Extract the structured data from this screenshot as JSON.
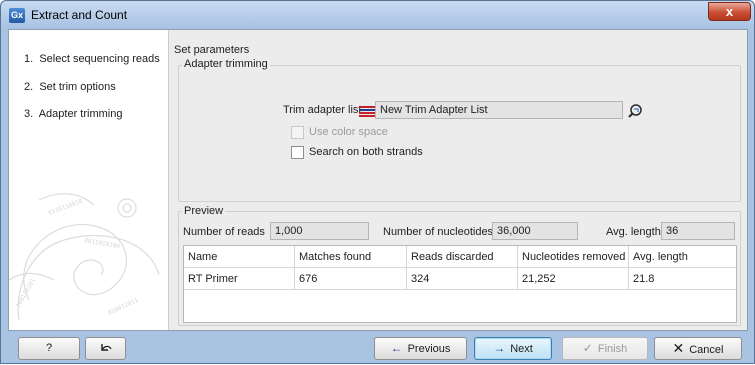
{
  "window": {
    "app_icon": "Gx",
    "title": "Extract and Count",
    "close_glyph": "x"
  },
  "sidebar": {
    "steps": [
      {
        "number": "1.",
        "label": "Select sequencing reads"
      },
      {
        "number": "2.",
        "label": "Set trim options"
      },
      {
        "number": "3.",
        "label": "Adapter trimming"
      }
    ]
  },
  "main": {
    "section_title": "Set parameters",
    "adapter_group": {
      "title": "Adapter trimming",
      "trim_label": "Trim adapter list",
      "trim_value": "New Trim Adapter List",
      "browse_icon": "browse-icon",
      "use_color_space": {
        "label": "Use color space",
        "checked": false,
        "enabled": false
      },
      "search_both": {
        "label": "Search on both strands",
        "checked": false,
        "enabled": true
      }
    },
    "preview": {
      "title": "Preview",
      "reads_label": "Number of reads",
      "reads_value": "1,000",
      "nucleotides_label": "Number of nucleotides",
      "nucleotides_value": "36,000",
      "avg_label": "Avg. length",
      "avg_value": "36",
      "table": {
        "columns": [
          "Name",
          "Matches found",
          "Reads discarded",
          "Nucleotides removed",
          "Avg. length"
        ],
        "rows": [
          [
            "RT Primer",
            "676",
            "324",
            "21,252",
            "21.8"
          ]
        ]
      }
    }
  },
  "footer": {
    "help": "?",
    "reset_icon": "reset-icon",
    "previous": "Previous",
    "next": "Next",
    "finish": "Finish",
    "cancel": "Cancel"
  },
  "colors": {
    "titlebar": "#a9c4e2",
    "content_bg": "#ececec",
    "flag_red": "#c8202a",
    "flag_blue": "#1c3e93"
  }
}
